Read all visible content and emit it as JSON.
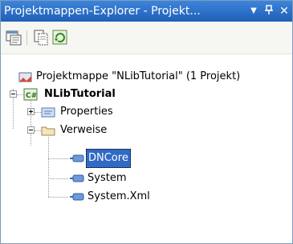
{
  "window": {
    "title": "Projektmappen-Explorer - Projekt...",
    "menu_glyph": "▾",
    "pin_glyph": "ᵽ",
    "close_glyph": "✕"
  },
  "toolbar": {
    "icons": [
      "properties-icon",
      "show-all-files-icon",
      "refresh-icon"
    ]
  },
  "tree": {
    "solution": "Projektmappe \"NLibTutorial\" (1 Projekt)",
    "project": "NLibTutorial",
    "properties": "Properties",
    "references": "Verweise",
    "ref_items": [
      "DNCore",
      "System",
      "System.Xml"
    ],
    "selected": "DNCore"
  },
  "colors": {
    "titlebar": "#2a6ccb",
    "selection": "#316ac5"
  }
}
